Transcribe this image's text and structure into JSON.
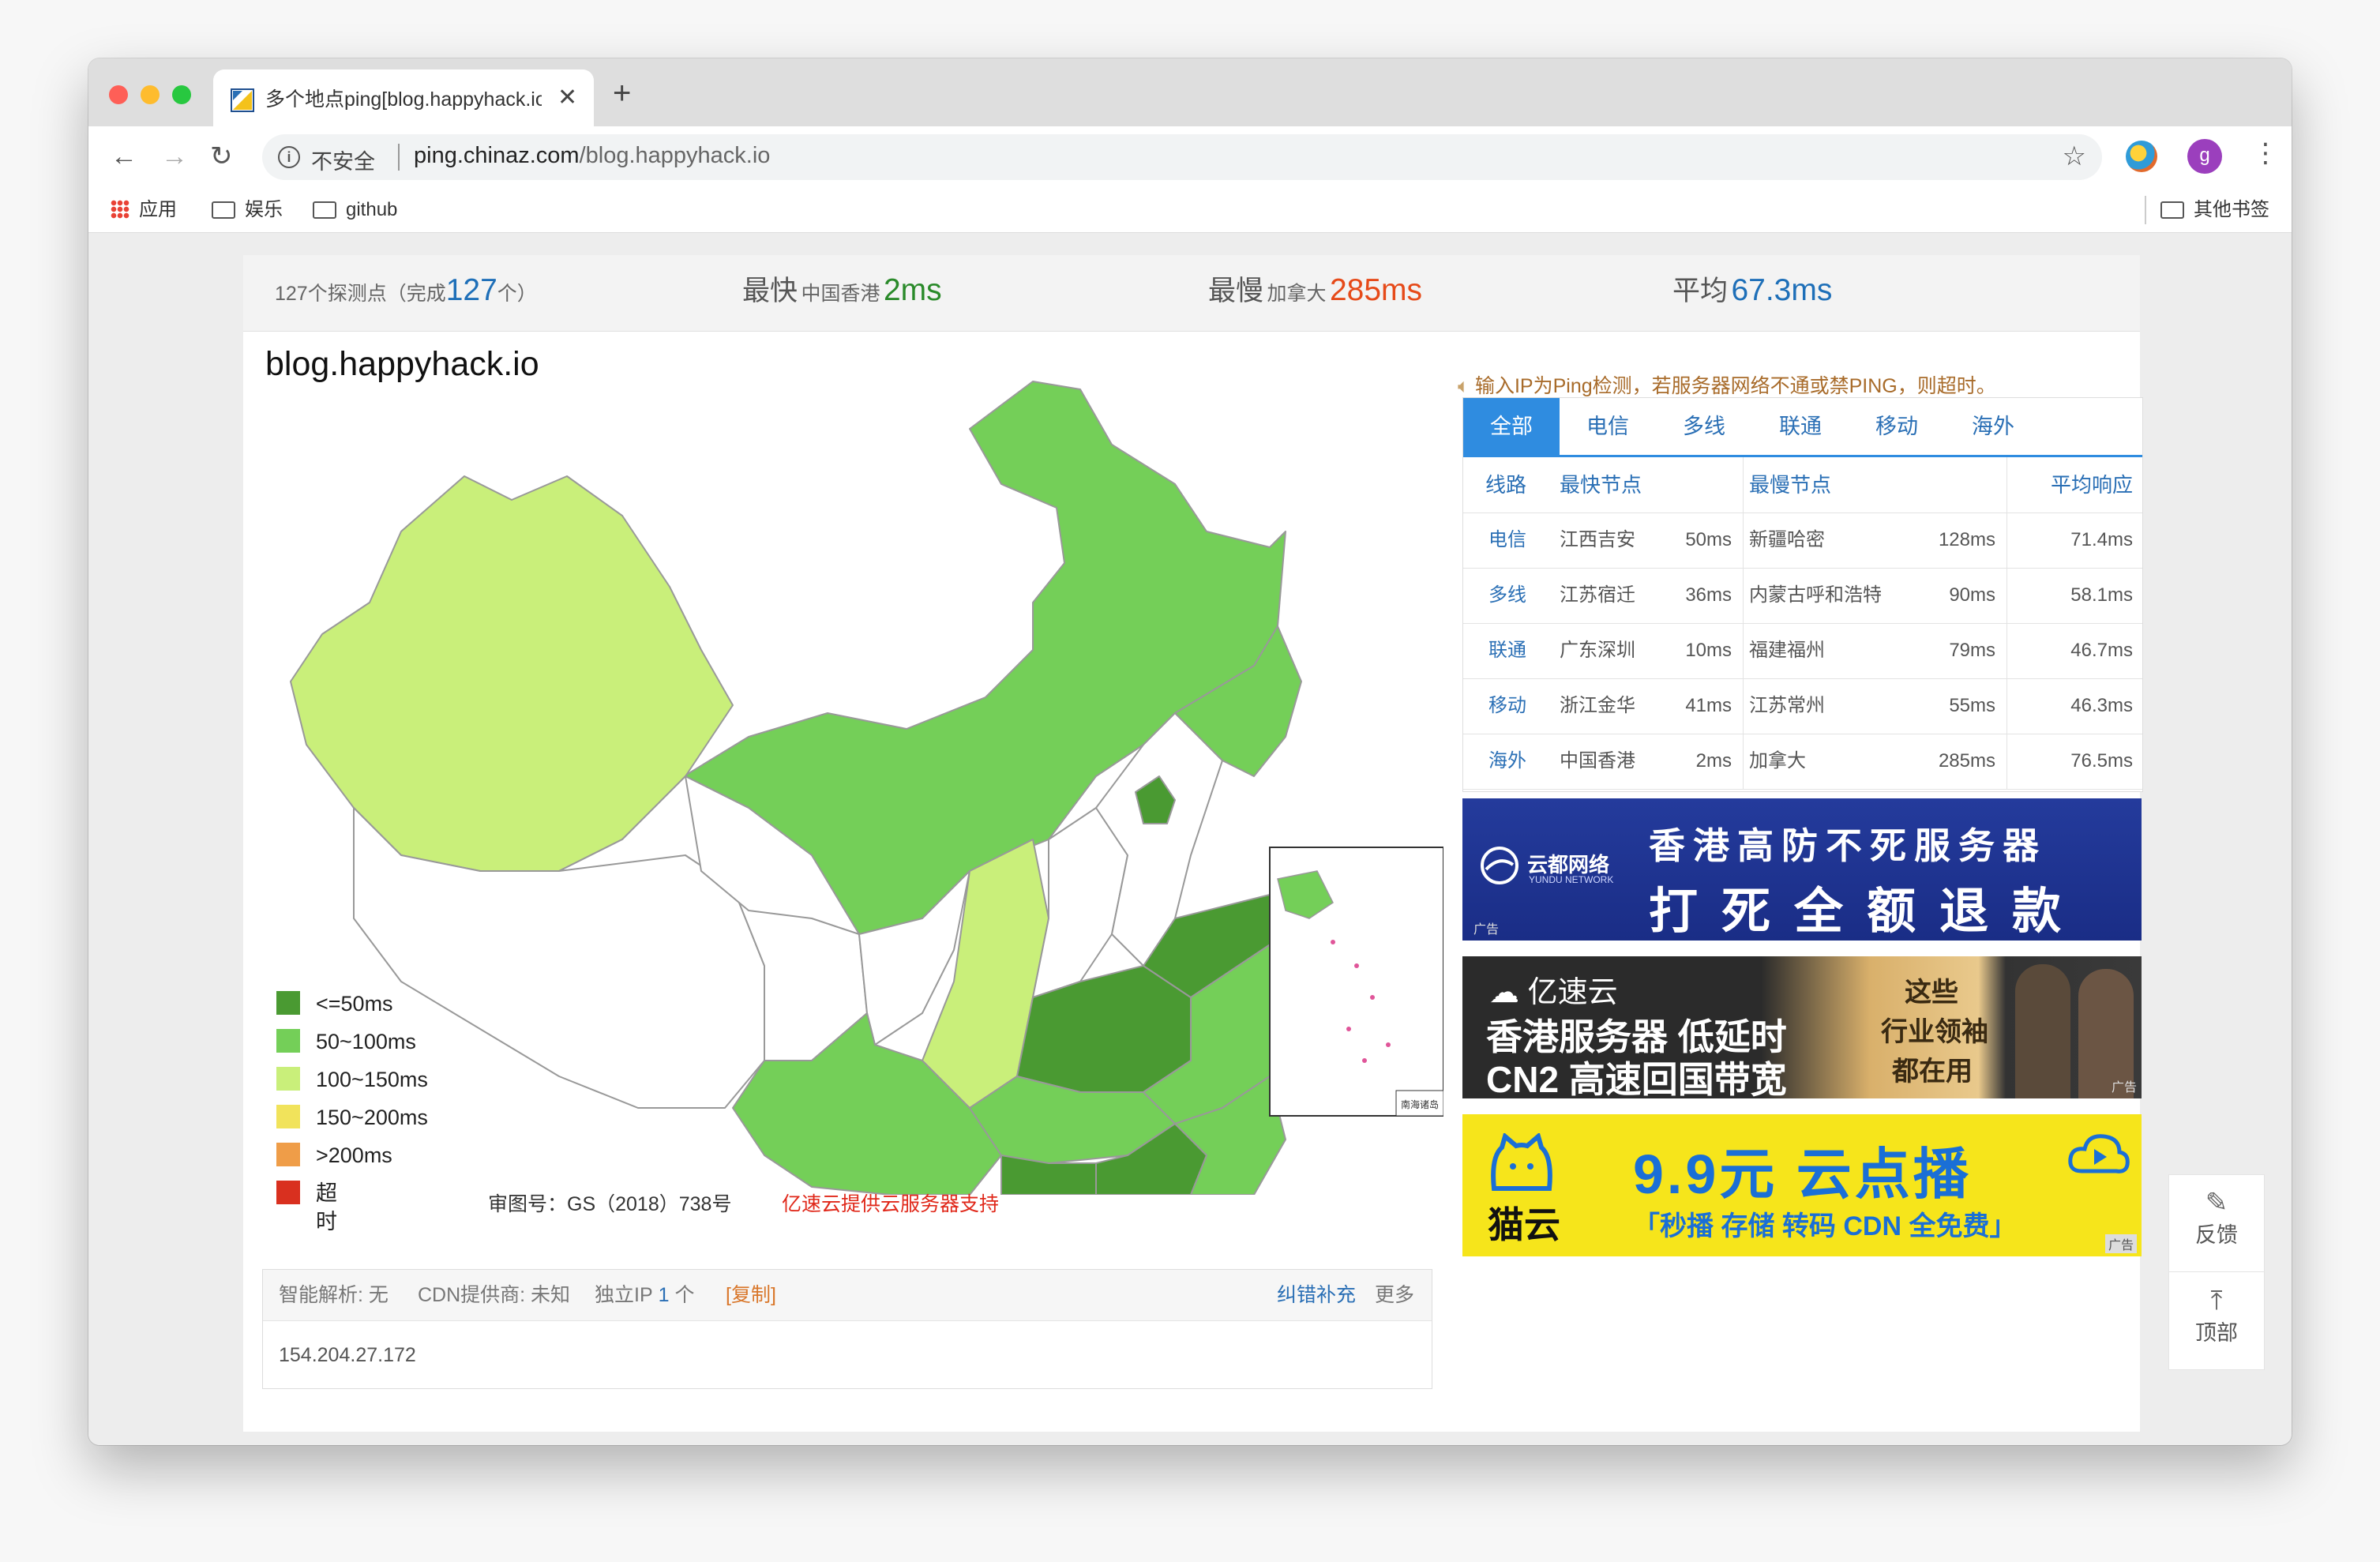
{
  "browser": {
    "tab_title": "多个地点ping[blog.happyhack.io",
    "tab_close": "✕",
    "new_tab": "+",
    "nav": {
      "back": "←",
      "forward": "→",
      "reload": "↻"
    },
    "security_label": "不安全",
    "url_host": "ping.chinaz.com",
    "url_path": "/blog.happyhack.io",
    "bookmark_star": "☆",
    "profile_initial": "g",
    "menu": "⋮",
    "bookmarks": {
      "apps": "应用",
      "items": [
        "娱乐",
        "github"
      ],
      "other": "其他书签"
    }
  },
  "stats": {
    "probe_prefix": "127个探测点（完成",
    "probe_count": "127",
    "probe_suffix": "个）",
    "fastest_label": "最快",
    "fastest_loc": "中国香港",
    "fastest_val": "2ms",
    "slowest_label": "最慢",
    "slowest_loc": "加拿大",
    "slowest_val": "285ms",
    "avg_label": "平均",
    "avg_val": "67.3ms"
  },
  "host": "blog.happyhack.io",
  "map": {
    "colors": {
      "le50": "#4a9a32",
      "50_100": "#74cf58",
      "100_150": "#c9ef7a",
      "150_200": "#f1e35b",
      "gt200": "#ef9d48",
      "timeout": "#d9301f",
      "no_data": "#ffffff"
    },
    "inset_title": "南海诸岛"
  },
  "legend": [
    {
      "label": "<=50ms",
      "color": "#4a9a32"
    },
    {
      "label": "50~100ms",
      "color": "#74cf58"
    },
    {
      "label": "100~150ms",
      "color": "#c9ef7a"
    },
    {
      "label": "150~200ms",
      "color": "#f1e35b"
    },
    {
      "label": ">200ms",
      "color": "#ef9d48"
    },
    {
      "label": "超时",
      "color": "#d9301f"
    }
  ],
  "approval": "审图号：GS（2018）738号",
  "sponsor": "亿速云提供云服务器支持",
  "info": {
    "dns": "智能解析: 无",
    "cdn": "CDN提供商: 未知",
    "ip_label": "独立IP",
    "ip_count": "1",
    "ip_unit": "个",
    "copy": "[复制]",
    "correct": "纠错补充",
    "more": "更多",
    "ip": "154.204.27.172"
  },
  "notice": "输入IP为Ping检测，若服务器网络不通或禁PING，则超时。",
  "panel": {
    "tabs": [
      "全部",
      "电信",
      "多线",
      "联通",
      "移动",
      "海外"
    ],
    "headers": {
      "line": "线路",
      "fast": "最快节点",
      "slow": "最慢节点",
      "avg": "平均响应"
    },
    "rows": [
      {
        "line": "电信",
        "fast": "江西吉安",
        "fast_ms": "50ms",
        "slow": "新疆哈密",
        "slow_ms": "128ms",
        "avg": "71.4ms"
      },
      {
        "line": "多线",
        "fast": "江苏宿迁",
        "fast_ms": "36ms",
        "slow": "内蒙古呼和浩特",
        "slow_ms": "90ms",
        "avg": "58.1ms"
      },
      {
        "line": "联通",
        "fast": "广东深圳",
        "fast_ms": "10ms",
        "slow": "福建福州",
        "slow_ms": "79ms",
        "avg": "46.7ms"
      },
      {
        "line": "移动",
        "fast": "浙江金华",
        "fast_ms": "41ms",
        "slow": "江苏常州",
        "slow_ms": "55ms",
        "avg": "46.3ms"
      },
      {
        "line": "海外",
        "fast": "中国香港",
        "fast_ms": "2ms",
        "slow": "加拿大",
        "slow_ms": "285ms",
        "avg": "76.5ms"
      }
    ]
  },
  "ads": {
    "ad1": {
      "brand": "云都网络",
      "brand_en": "YUNDU NETWORK",
      "line1": "香港高防不死服务器",
      "line2": "打死全额退款",
      "tag": "广告"
    },
    "ad2": {
      "brand": "亿速云",
      "line1": "香港服务器 低延时",
      "line2": "CN2 高速回国带宽",
      "right1": "这些",
      "right2": "行业领袖",
      "right3": "都在用",
      "tag": "广告"
    },
    "ad3": {
      "brand": "猫云",
      "headline": "9.9元 云点播",
      "sub": "「秒播 存储 转码 CDN 全免费」",
      "tag": "广告"
    }
  },
  "float": {
    "feedback": "反馈",
    "top": "顶部"
  }
}
